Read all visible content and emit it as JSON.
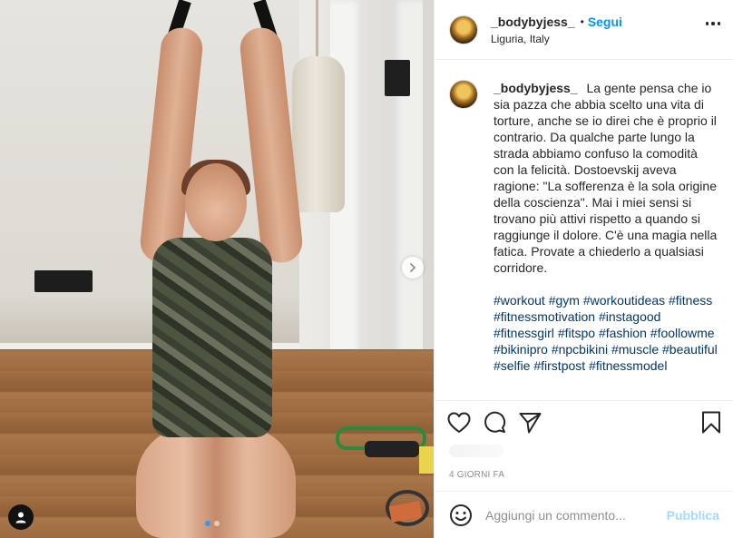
{
  "post": {
    "image_alt": "Woman pulling on suspension straps while kneeling",
    "carousel": {
      "slide_count": 2,
      "active_index": 0
    }
  },
  "header": {
    "username": "_bodybyjess_",
    "separator": "•",
    "follow_label": "Segui",
    "location": "Liguria, Italy"
  },
  "caption": {
    "username": "_bodybyjess_",
    "text": "La gente pensa che io sia pazza che abbia scelto una vita di torture, anche se io direi che è proprio il contrario. Da qualche parte lungo la strada abbiamo confuso la comodità con la felicità. Dostoevskij aveva ragione: \"La sofferenza è la sola origine della coscienza\". Mai i miei sensi si trovano più attivi rispetto a quando si raggiunge il dolore. C'è una magia nella fatica. Provate a chiederlo a qualsiasi corridore.",
    "hashtags": [
      "#workout",
      "#gym",
      "#workoutideas",
      "#fitness",
      "#fitnessmotivation",
      "#instagood",
      "#fitnessgirl",
      "#fitspo",
      "#fashion",
      "#foollowme",
      "#bikinipro",
      "#npcbikini",
      "#muscle",
      "#beautiful",
      "#selfie",
      "#firstpost",
      "#fitnessmodel"
    ]
  },
  "icons": {
    "like": "heart-icon",
    "comment": "comment-icon",
    "share": "paper-plane-icon",
    "save": "bookmark-icon",
    "more": "more-icon",
    "next": "chevron-right-icon",
    "tags": "user-icon",
    "emoji": "emoji-icon"
  },
  "date": "4 GIORNI FA",
  "comment_box": {
    "placeholder": "Aggiungi un commento...",
    "publish_label": "Pubblica"
  },
  "colors": {
    "link_blue": "#0095f6",
    "hashtag": "#00376b",
    "muted": "#8e8e8e",
    "text": "#262626"
  }
}
